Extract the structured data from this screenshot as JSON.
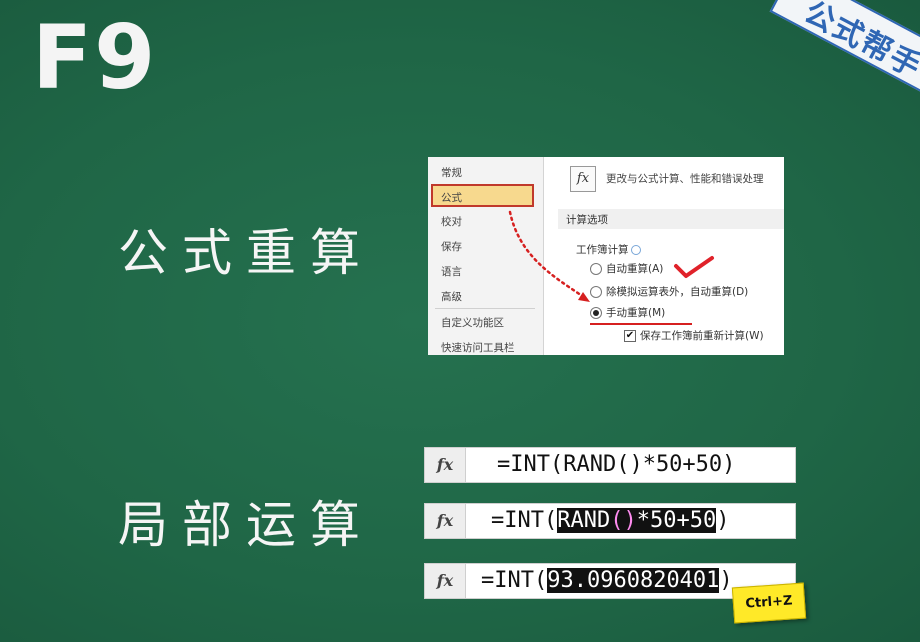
{
  "title_key": "F9",
  "corner_banner": "公式帮手",
  "sections": {
    "recalc_label": "公式重算",
    "partial_label": "局部运算"
  },
  "options_dialog": {
    "sidebar": {
      "items": [
        "常规",
        "公式",
        "校对",
        "保存",
        "语言",
        "高级",
        "自定义功能区",
        "快速访问工具栏"
      ],
      "selected": "公式"
    },
    "header_text": "更改与公式计算、性能和错误处理",
    "section_title": "计算选项",
    "group_title": "工作簿计算",
    "radios": [
      {
        "label": "自动重算(A)",
        "checked": false
      },
      {
        "label": "除模拟运算表外，自动重算(D)",
        "checked": false
      },
      {
        "label": "手动重算(M)",
        "checked": true
      }
    ],
    "checkbox": {
      "label": "保存工作簿前重新计算(W)",
      "checked": true
    },
    "icon": "fx-icon",
    "annotation_colors": {
      "check": "#e0222a",
      "arrow": "#d62020",
      "underline": "#d62020"
    }
  },
  "formula_bars": [
    {
      "fx": "fx",
      "prefix": "=INT(RAND()*50+50)",
      "highlight": "",
      "suffix": ""
    },
    {
      "fx": "fx",
      "prefix": "=INT(",
      "highlight_parts": [
        "RAND",
        "()",
        "*50+50"
      ],
      "suffix": ")"
    },
    {
      "fx": "fx",
      "prefix": "=INT(",
      "highlight": "93.0960820401",
      "suffix": ")"
    }
  ],
  "key_badge": "Ctrl+Z",
  "colors": {
    "background": "#1f6646",
    "text": "#f5f5f5",
    "badge": "#ffe928"
  }
}
